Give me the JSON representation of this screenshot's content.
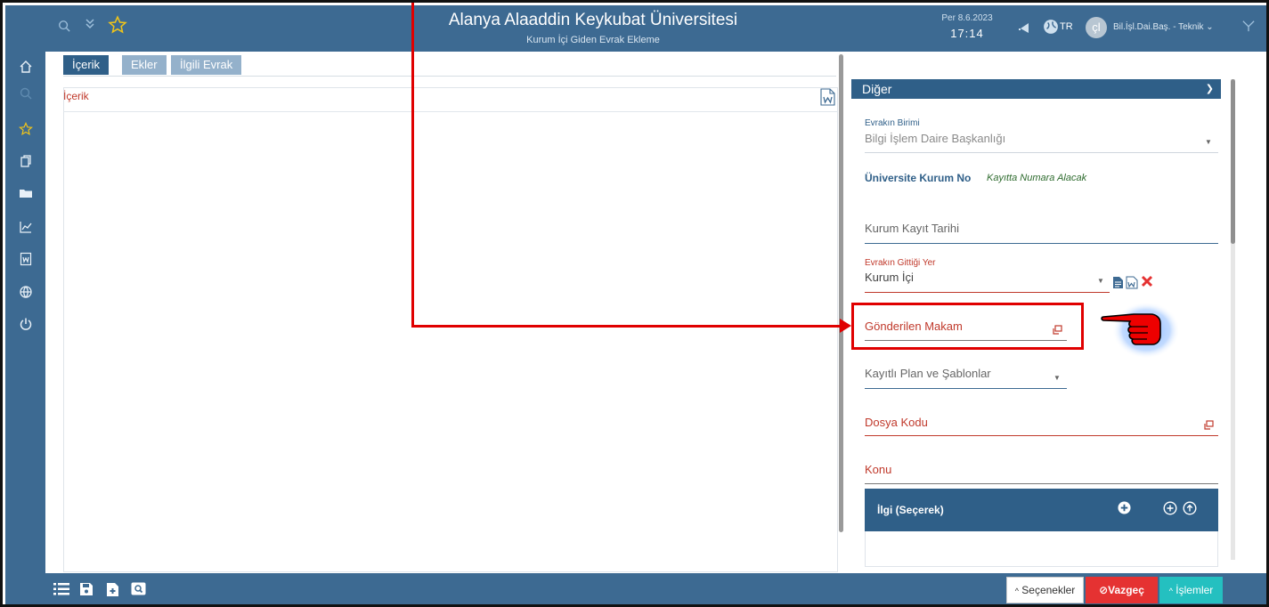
{
  "header": {
    "title": "Alanya Alaaddin Keykubat Üniversitesi",
    "subtitle": "Kurum İçi Giden Evrak Ekleme",
    "date": "Per 8.6.2023",
    "time": "17:14",
    "language": "TR",
    "avatar_initials": "çl",
    "user": "Bil.İşl.Dai.Baş. - Teknik"
  },
  "tabs": [
    {
      "label": "İçerik",
      "active": true
    },
    {
      "label": "Ekler",
      "active": false
    },
    {
      "label": "İlgili Evrak",
      "active": false
    }
  ],
  "content": {
    "label": "İçerik"
  },
  "right_panel": {
    "section_title": "Diğer",
    "evrak_birimi_label": "Evrakın Birimi",
    "evrak_birimi_value": "Bilgi İşlem Daire Başkanlığı",
    "kurum_no_label": "Üniversite Kurum No",
    "kurum_no_value": "Kayıtta Numara Alacak",
    "kayit_tarihi_placeholder": "Kurum Kayıt Tarihi",
    "gittigi_yer_label": "Evrakın Gittiği Yer",
    "gittigi_yer_value": "Kurum İçi",
    "gonderilen_makam": "Gönderilen Makam",
    "plan_sablon": "Kayıtlı Plan ve Şablonlar",
    "dosya_kodu": "Dosya Kodu",
    "konu": "Konu",
    "ilgi": "İlgi (Seçerek)"
  },
  "footer": {
    "secenekler": "Seçenekler",
    "vazgec": "Vazgeç",
    "islemler": "İşlemler"
  },
  "icons": [
    "home-icon",
    "search-icon",
    "star-icon",
    "documents-icon",
    "folder-icon",
    "chart-icon",
    "word-icon",
    "globe-icon",
    "power-icon",
    "double-chevron-icon",
    "bell-icon",
    "filter-icon",
    "list-icon",
    "save-icon",
    "new-file-icon",
    "preview-icon",
    "plus-circle-icon",
    "up-circle-icon",
    "close-icon",
    "popup-icon",
    "pointing-hand-icon"
  ],
  "colors": {
    "primary": "#3d6a92",
    "dark": "#2f5f88",
    "danger": "#e53232",
    "teal": "#24c0c0",
    "annotation": "#e00000"
  }
}
